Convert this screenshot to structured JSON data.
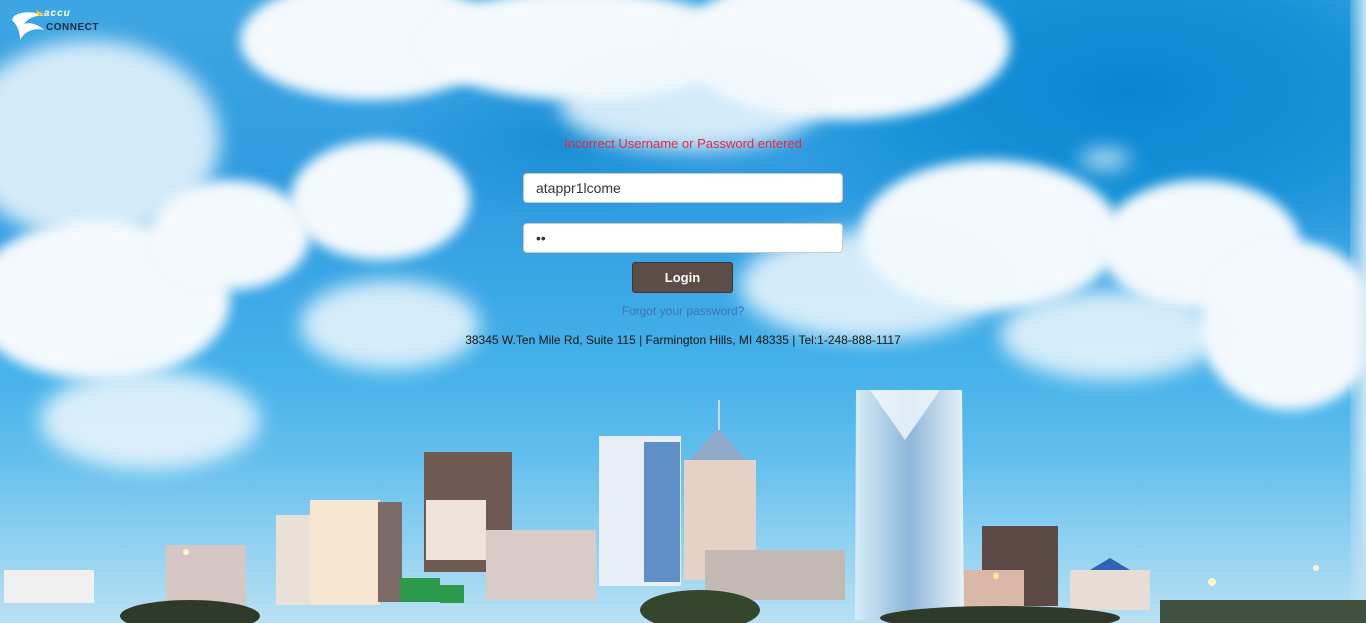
{
  "brand": {
    "logo_top": "accu",
    "logo_bottom": "CONNECT"
  },
  "login": {
    "error_message": "Incorrect Username or Password entered",
    "username_value": "atappr1lcome",
    "password_value": "••",
    "login_label": "Login",
    "forgot_password_label": "Forgot your password?"
  },
  "footer": {
    "address": "38345 W.Ten Mile Rd, Suite 115 | Farmington Hills, MI 48335 | Tel:1-248-888-1117"
  },
  "colors": {
    "error": "#e8263f",
    "button": "#5c4d46",
    "link": "#3e72b8",
    "sky": "#2f9be0"
  }
}
